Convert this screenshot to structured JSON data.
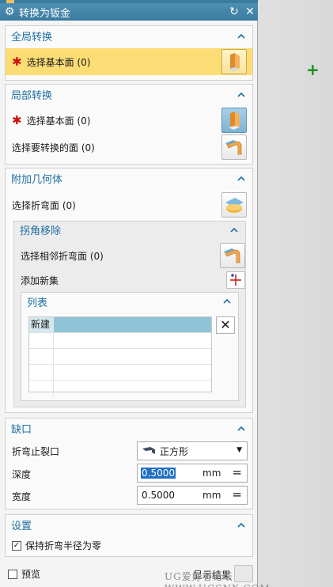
{
  "dialog": {
    "title": "转换为钣金",
    "reset_icon": "reset-icon",
    "close_icon": "close-icon"
  },
  "global_convert": {
    "header": "全局转换",
    "select_face_label": "选择基本面 (0)"
  },
  "local_convert": {
    "header": "局部转换",
    "select_face_label": "选择基本面 (0)",
    "select_convert_face_label": "选择要转换的面 (0)"
  },
  "additional_geometry": {
    "header": "附加几何体",
    "select_bend_label": "选择折弯面 (0)",
    "corner_removal": {
      "header": "拐角移除",
      "select_adjacent_bend_label": "选择相邻折弯面 (0)",
      "add_new_set_label": "添加新集",
      "list": {
        "header": "列表",
        "rows": [
          "新建",
          "",
          "",
          "",
          ""
        ]
      }
    }
  },
  "notch": {
    "header": "缺口",
    "bend_relief_label": "折弯止裂口",
    "bend_relief_value": "正方形",
    "depth_label": "深度",
    "depth_value": "0.5000",
    "depth_unit": "mm",
    "width_label": "宽度",
    "width_value": "0.5000",
    "width_unit": "mm"
  },
  "settings": {
    "header": "设置",
    "keep_bend_radius_label": "保持折弯半径为零",
    "keep_bend_radius_checked": true
  },
  "footer": {
    "preview_label": "预览",
    "show_result_label": "显示结果"
  },
  "watermark": "UG爱好者论坛 WWW.UGSNX.COM",
  "colors": {
    "title_bar": "#3a7ba0",
    "section_header": "#1e6fa0",
    "required_highlight": "#fbdc75",
    "required_star": "#d01010",
    "list_selection": "#8ec4d6"
  }
}
